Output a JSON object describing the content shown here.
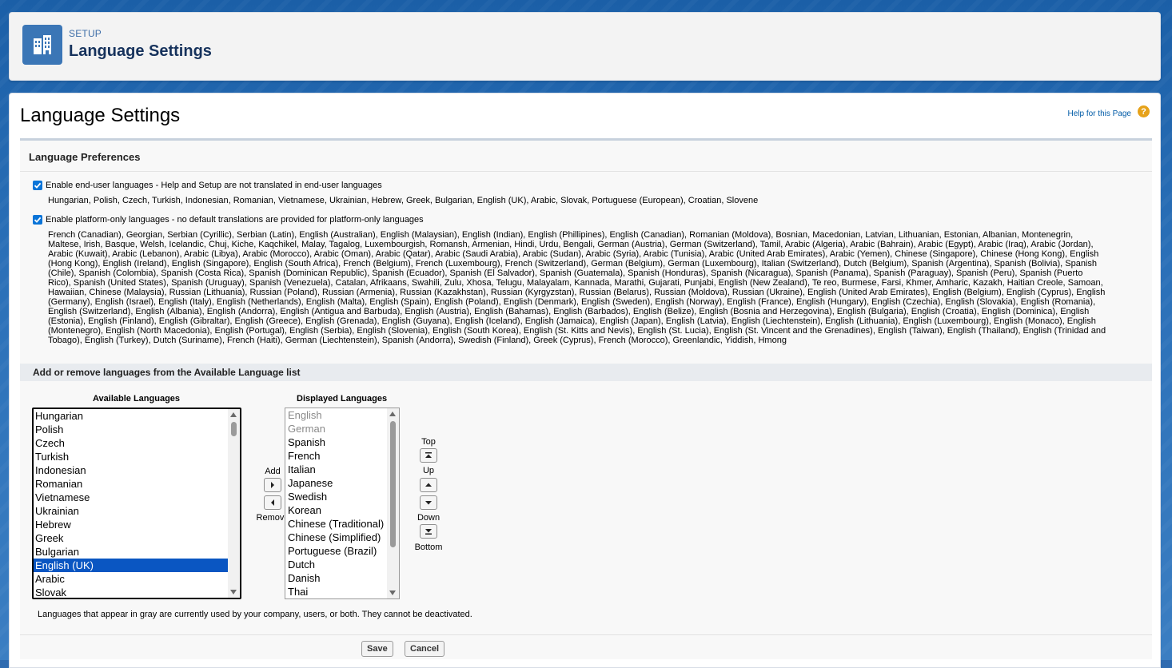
{
  "header": {
    "eyebrow": "SETUP",
    "title": "Language Settings",
    "icon": "building-icon"
  },
  "page": {
    "title": "Language Settings",
    "help_link": "Help for this Page",
    "help_icon": "question-icon"
  },
  "preferences": {
    "heading": "Language Preferences",
    "end_user": {
      "checked": true,
      "label": "Enable end-user languages - Help and Setup are not translated in end-user languages",
      "languages": "Hungarian, Polish, Czech, Turkish, Indonesian, Romanian, Vietnamese, Ukrainian, Hebrew, Greek, Bulgarian, English (UK), Arabic, Slovak, Portuguese (European), Croatian, Slovene"
    },
    "platform_only": {
      "checked": true,
      "label": "Enable platform-only languages - no default translations are provided for platform-only languages",
      "lines": [
        "French (Canadian), Georgian, Serbian (Cyrillic), Serbian (Latin), English (Australian), English (Malaysian), English (Indian), English (Phillipines), English (Canadian), Romanian (Moldova), Bosnian, Macedonian, Latvian, Lithuanian, Estonian, Albanian, Montenegrin,",
        "Maltese, Irish, Basque, Welsh, Icelandic, Chuj, Kiche, Kaqchikel, Malay, Tagalog, Luxembourgish, Romansh, Armenian, Hindi, Urdu, Bengali, German (Austria), German (Switzerland), Tamil, Arabic (Algeria), Arabic (Bahrain), Arabic (Egypt), Arabic (Iraq), Arabic (Jordan),",
        "Arabic (Kuwait), Arabic (Lebanon), Arabic (Libya), Arabic (Morocco), Arabic (Oman), Arabic (Qatar), Arabic (Saudi Arabia), Arabic (Sudan), Arabic (Syria), Arabic (Tunisia), Arabic (United Arab Emirates), Arabic (Yemen), Chinese (Singapore), Chinese (Hong Kong), English",
        "(Hong Kong), English (Ireland), English (Singapore), English (South Africa), French (Belgium), French (Luxembourg), French (Switzerland), German (Belgium), German (Luxembourg), Italian (Switzerland), Dutch (Belgium), Spanish (Argentina), Spanish (Bolivia), Spanish",
        "(Chile), Spanish (Colombia), Spanish (Costa Rica), Spanish (Dominican Republic), Spanish (Ecuador), Spanish (El Salvador), Spanish (Guatemala), Spanish (Honduras), Spanish (Nicaragua), Spanish (Panama), Spanish (Paraguay), Spanish (Peru), Spanish (Puerto",
        "Rico), Spanish (United States), Spanish (Uruguay), Spanish (Venezuela), Catalan, Afrikaans, Swahili, Zulu, Xhosa, Telugu, Malayalam, Kannada, Marathi, Gujarati, Punjabi, English (New Zealand), Te reo, Burmese, Farsi, Khmer, Amharic, Kazakh, Haitian Creole, Samoan,",
        "Hawaiian, Chinese (Malaysia), Russian (Lithuania), Russian (Poland), Russian (Armenia), Russian (Kazakhstan), Russian (Kyrgyzstan), Russian (Belarus), Russian (Moldova), Russian (Ukraine), English (United Arab Emirates), English (Belgium), English (Cyprus), English",
        "(Germany), English (Israel), English (Italy), English (Netherlands), English (Malta), English (Spain), English (Poland), English (Denmark), English (Sweden), English (Norway), English (France), English (Hungary), English (Czechia), English (Slovakia), English (Romania),",
        "English (Switzerland), English (Albania), English (Andorra), English (Antigua and Barbuda), English (Austria), English (Bahamas), English (Barbados), English (Belize), English (Bosnia and Herzegovina), English (Bulgaria), English (Croatia), English (Dominica), English",
        "(Estonia), English (Finland), English (Gibraltar), English (Greece), English (Grenada), English (Guyana), English (Iceland), English (Jamaica), English (Japan), English (Latvia), English (Liechtenstein), English (Lithuania), English (Luxembourg), English (Monaco), English",
        "(Montenegro), English (North Macedonia), English (Portugal), English (Serbia), English (Slovenia), English (South Korea), English (St. Kitts and Nevis), English (St. Lucia), English (St. Vincent and the Grenadines), English (Taiwan), English (Thailand), English (Trinidad and",
        "Tobago), English (Turkey), Dutch (Suriname), French (Haiti), German (Liechtenstein), Spanish (Andorra), Swedish (Finland), Greek (Cyprus), French (Morocco), Greenlandic, Yiddish, Hmong"
      ]
    }
  },
  "add_remove": {
    "heading": "Add or remove languages from the Available Language list",
    "available_label": "Available Languages",
    "displayed_label": "Displayed Languages",
    "available": [
      "Hungarian",
      "Polish",
      "Czech",
      "Turkish",
      "Indonesian",
      "Romanian",
      "Vietnamese",
      "Ukrainian",
      "Hebrew",
      "Greek",
      "Bulgarian",
      "English (UK)",
      "Arabic",
      "Slovak"
    ],
    "available_selected": "English (UK)",
    "displayed": [
      {
        "label": "English",
        "gray": true
      },
      {
        "label": "German",
        "gray": true
      },
      {
        "label": "Spanish",
        "gray": false
      },
      {
        "label": "French",
        "gray": false
      },
      {
        "label": "Italian",
        "gray": false
      },
      {
        "label": "Japanese",
        "gray": false
      },
      {
        "label": "Swedish",
        "gray": false
      },
      {
        "label": "Korean",
        "gray": false
      },
      {
        "label": "Chinese (Traditional)",
        "gray": false
      },
      {
        "label": "Chinese (Simplified)",
        "gray": false
      },
      {
        "label": "Portuguese (Brazil)",
        "gray": false
      },
      {
        "label": "Dutch",
        "gray": false
      },
      {
        "label": "Danish",
        "gray": false
      },
      {
        "label": "Thai",
        "gray": false
      }
    ],
    "add_label": "Add",
    "remove_label": "Remove",
    "top_label": "Top",
    "up_label": "Up",
    "down_label": "Down",
    "bottom_label": "Bottom",
    "footnote": "Languages that appear in gray are currently used by your company, users, or both. They cannot be deactivated."
  },
  "footer": {
    "save_label": "Save",
    "cancel_label": "Cancel"
  },
  "colors": {
    "accent": "#0a74d8",
    "selection": "#0a56c2",
    "header_text": "#16325c"
  }
}
